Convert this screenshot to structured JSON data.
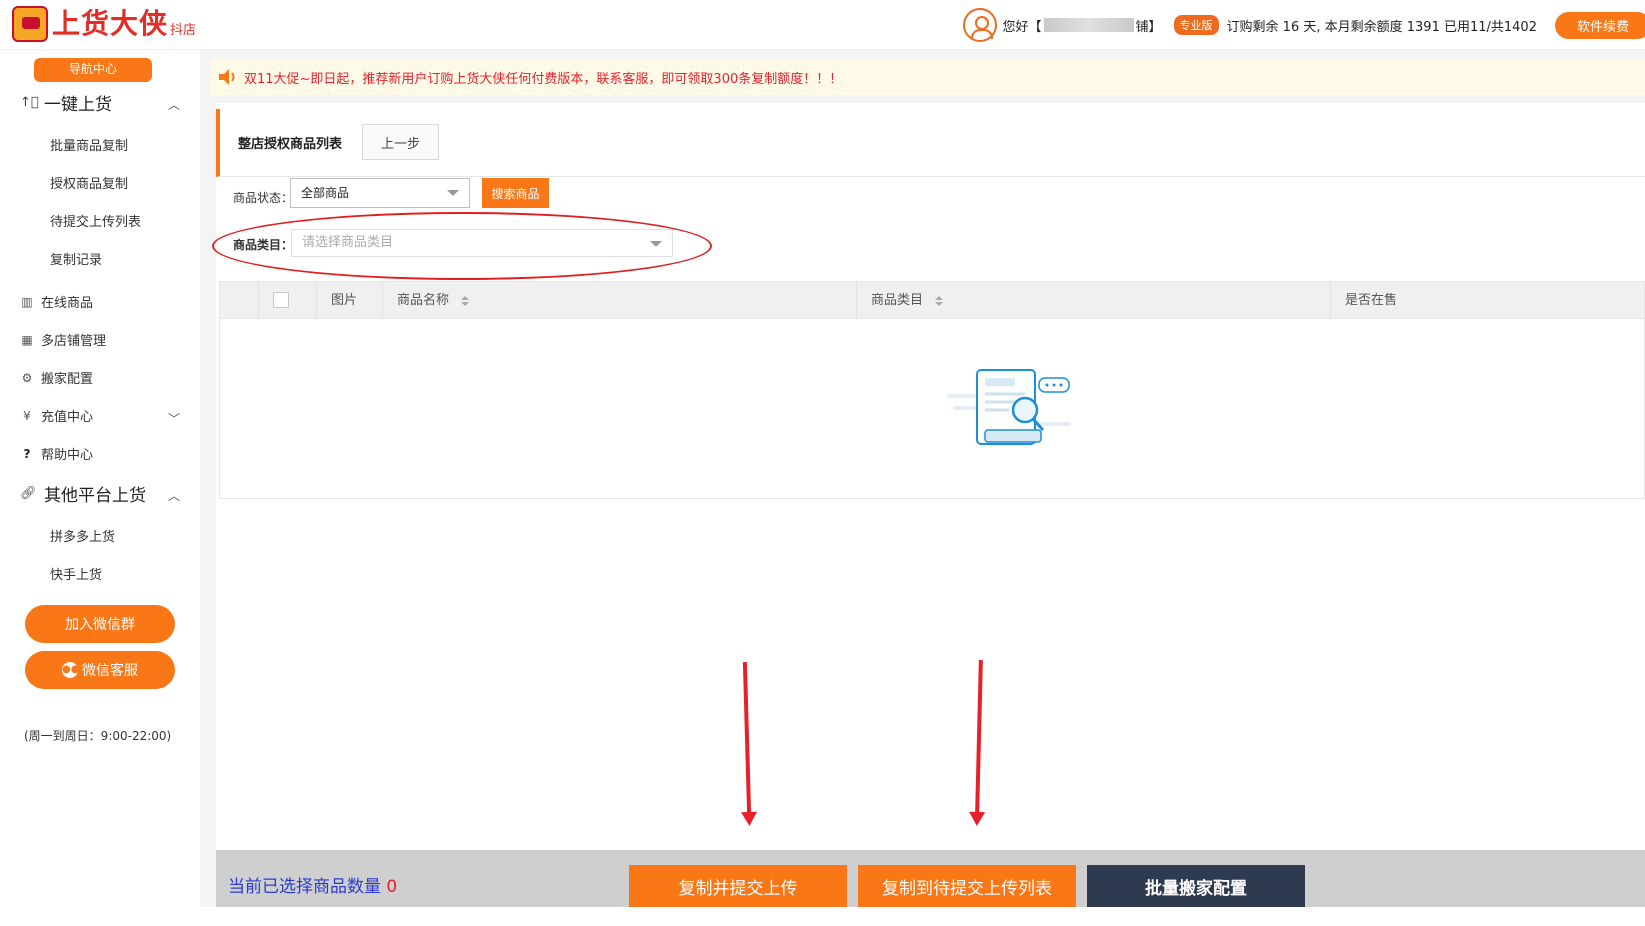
{
  "brand": {
    "name": "上货大侠",
    "sub": "抖店"
  },
  "user": {
    "greeting_prefix": "您好【",
    "name_suffix": "铺】",
    "badge": "专业版",
    "quota": "订购剩余 16 天, 本月剩余额度 1391 已用11/共1402",
    "renew_label": "软件续费"
  },
  "sidebar": {
    "nav_center": "导航中心",
    "group_one_click": "一键上货",
    "one_click_items": [
      "批量商品复制",
      "授权商品复制",
      "待提交上传列表",
      "复制记录"
    ],
    "online_goods": "在线商品",
    "multi_store": "多店铺管理",
    "move_config": "搬家配置",
    "recharge": "充值中心",
    "help": "帮助中心",
    "group_other": "其他平台上货",
    "other_items": [
      "拼多多上货",
      "快手上货"
    ],
    "join_wechat": "加入微信群",
    "wechat_service": "微信客服",
    "hours": "(周一到周日：9:00-22:00)"
  },
  "notice": "双11大促~即日起，推荐新用户订购上货大侠任何付费版本，联系客服，即可领取300条复制额度！！！",
  "panel": {
    "title": "整店授权商品列表",
    "prev_label": "上一步",
    "status_label": "商品状态：",
    "status_value": "全部商品",
    "search_label": "搜索商品",
    "category_label": "商品类目：",
    "category_placeholder": "请选择商品类目"
  },
  "table": {
    "headers": [
      "图片",
      "商品名称",
      "商品类目",
      "是否在售"
    ]
  },
  "bottom": {
    "selected_label": "当前已选择商品数量",
    "selected_count": "0",
    "btn_copy_submit": "复制并提交上传",
    "btn_copy_pending": "复制到待提交上传列表",
    "btn_batch_config": "批量搬家配置"
  },
  "colors": {
    "accent": "#f97716",
    "alert": "#e8202a",
    "dark_button": "#2e3a4f"
  }
}
